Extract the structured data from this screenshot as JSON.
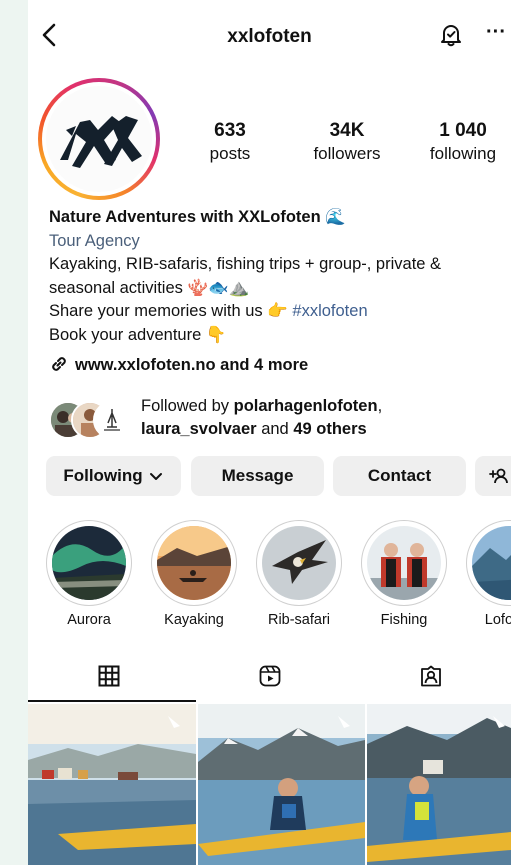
{
  "header": {
    "username": "xxlofoten"
  },
  "stats": [
    {
      "value": "633",
      "label": "posts"
    },
    {
      "value": "34K",
      "label": "followers"
    },
    {
      "value": "1 040",
      "label": "following"
    }
  ],
  "bio": {
    "name": "Nature Adventures with XXLofoten",
    "category": "Tour Agency",
    "line1": "Kayaking, RIB-safaris, fishing trips + group-, private &",
    "line2": "seasonal activities",
    "line3": "Share your memories with us",
    "hashtag": "#xxlofoten",
    "line4": "Book your adventure"
  },
  "link": {
    "text": "www.xxlofoten.no and 4 more"
  },
  "followed_by": {
    "prefix": "Followed by",
    "user1": "polarhagenlofoten",
    "user2": "laura_svolvaer",
    "and": "and",
    "others": "49 others"
  },
  "buttons": {
    "following": "Following",
    "message": "Message",
    "contact": "Contact"
  },
  "highlights": [
    {
      "label": "Aurora"
    },
    {
      "label": "Kayaking"
    },
    {
      "label": "Rib-safari"
    },
    {
      "label": "Fishing"
    },
    {
      "label": "Lofoten"
    }
  ]
}
